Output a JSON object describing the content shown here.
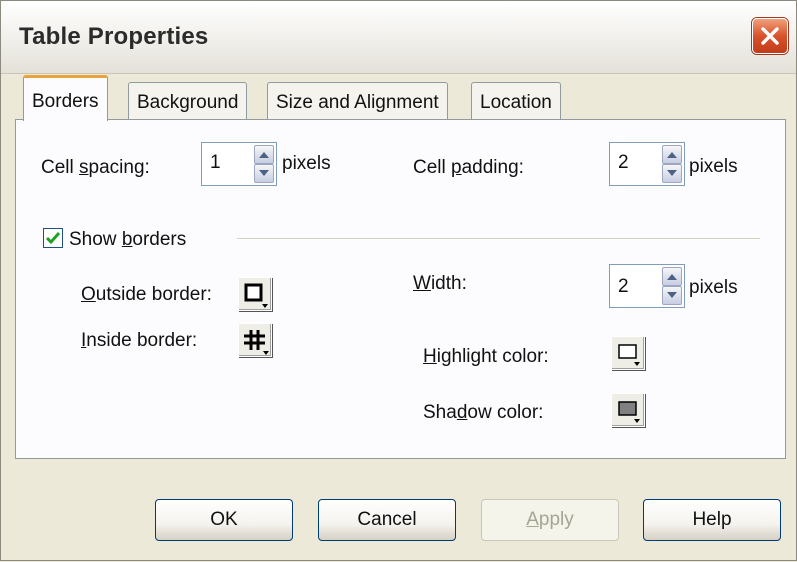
{
  "window": {
    "title": "Table Properties"
  },
  "tabs": [
    {
      "label": "Borders",
      "active": true
    },
    {
      "label": "Background"
    },
    {
      "label": "Size and Alignment"
    },
    {
      "label": "Location"
    }
  ],
  "cell_spacing": {
    "label_pre": "Cell ",
    "label_key": "s",
    "label_post": "pacing:",
    "value": "1",
    "unit": "pixels"
  },
  "cell_padding": {
    "label_pre": "Cell ",
    "label_key": "p",
    "label_post": "adding:",
    "value": "2",
    "unit": "pixels"
  },
  "show_borders": {
    "label_pre": "Show ",
    "label_key": "b",
    "label_post": "orders",
    "checked": true
  },
  "outside_border": {
    "label_key": "O",
    "label_post": "utside border:",
    "icon": "outside-border-icon"
  },
  "inside_border": {
    "label_key": "I",
    "label_post": "nside border:",
    "icon": "inside-border-icon"
  },
  "width": {
    "label_key": "W",
    "label_post": "idth:",
    "value": "2",
    "unit": "pixels"
  },
  "highlight_color": {
    "label_key": "H",
    "label_post": "ighlight color:",
    "icon": "highlight-color-icon",
    "color": "#ffffff"
  },
  "shadow_color": {
    "label_pre": "Sha",
    "label_key": "d",
    "label_post": "ow color:",
    "icon": "shadow-color-icon",
    "color": "#808080"
  },
  "buttons": {
    "ok": "OK",
    "cancel": "Cancel",
    "apply_key": "A",
    "apply_post": "pply",
    "apply_enabled": false,
    "help": "Help"
  },
  "colors": {
    "titlebar_text": "#2b2b2b",
    "close_button": "#d8532c",
    "active_tab_accent": "#e8a33c",
    "checkbox_check": "#21a121"
  }
}
